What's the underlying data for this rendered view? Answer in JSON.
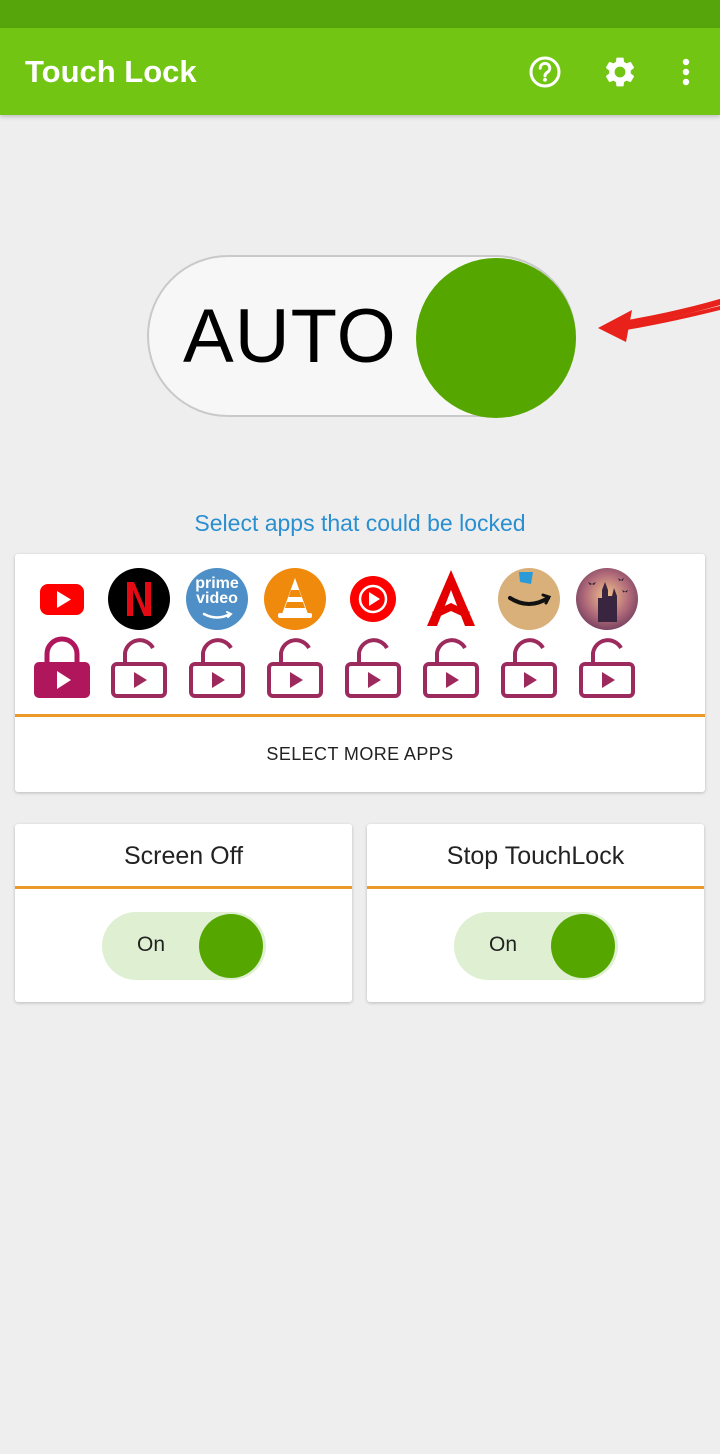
{
  "app_bar": {
    "title": "Touch Lock",
    "icons": [
      "help-circle-icon",
      "settings-gear-icon",
      "more-vert-icon"
    ]
  },
  "auto_toggle": {
    "label": "AUTO",
    "state": "on"
  },
  "select_hint": "Select apps that could be locked",
  "apps": [
    {
      "name": "YouTube",
      "icon": "youtube-icon",
      "locked": true
    },
    {
      "name": "Netflix",
      "icon": "netflix-icon",
      "locked": false
    },
    {
      "name": "Prime Video",
      "icon": "prime-video-icon",
      "icon_text": [
        "prime",
        "video"
      ],
      "locked": false
    },
    {
      "name": "VLC",
      "icon": "vlc-icon",
      "locked": false
    },
    {
      "name": "YouTube Music",
      "icon": "youtube-music-icon",
      "locked": false
    },
    {
      "name": "Airtel",
      "icon": "airtel-icon",
      "locked": false
    },
    {
      "name": "Amazon",
      "icon": "amazon-icon",
      "locked": false
    },
    {
      "name": "Game",
      "icon": "haunted-castle-icon",
      "locked": false
    }
  ],
  "select_more_label": "SELECT MORE APPS",
  "cards": [
    {
      "title": "Screen Off",
      "toggle_label": "On",
      "state": "on"
    },
    {
      "title": "Stop TouchLock",
      "toggle_label": "On",
      "state": "on"
    }
  ],
  "colors": {
    "app_bar": "#72c613",
    "status_bar": "#56a50a",
    "knob_green": "#55a700",
    "link_blue": "#2a8fd1",
    "divider_orange": "#eb9a2a",
    "lock_locked": "#b0165c",
    "lock_unlocked": "#9c2a5c"
  }
}
